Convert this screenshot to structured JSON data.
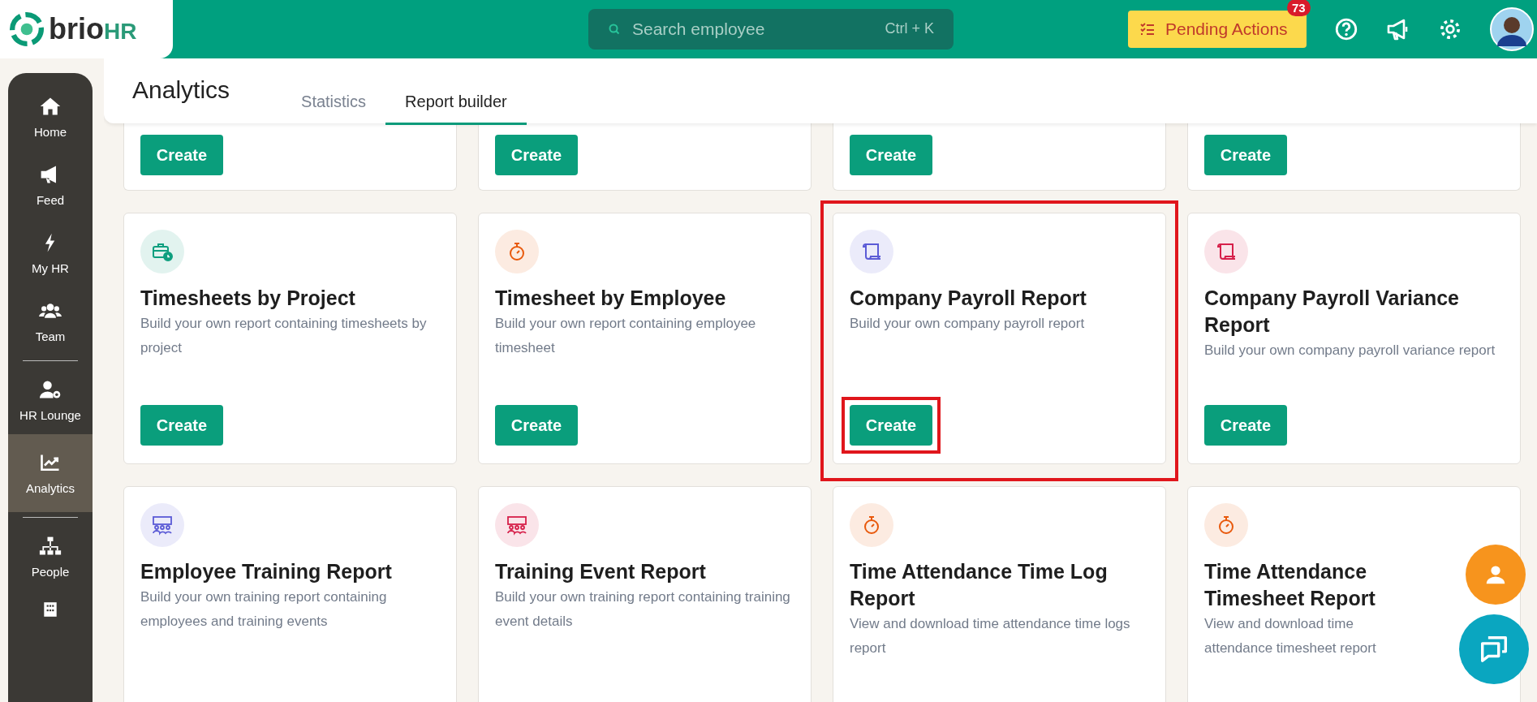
{
  "topbar": {
    "logo": {
      "name": "brio",
      "suffix": "HR"
    },
    "search": {
      "placeholder": "Search employee",
      "shortcut": "Ctrl + K"
    },
    "pending": {
      "label": "Pending Actions",
      "count": "73"
    }
  },
  "sidebar": {
    "items": [
      {
        "label": "Home",
        "selected": false,
        "divider_after": false
      },
      {
        "label": "Feed",
        "selected": false,
        "divider_after": false
      },
      {
        "label": "My HR",
        "selected": false,
        "divider_after": false
      },
      {
        "label": "Team",
        "selected": false,
        "divider_after": true
      },
      {
        "label": "HR Lounge",
        "selected": false,
        "divider_after": false
      },
      {
        "label": "Analytics",
        "selected": true,
        "divider_after": true
      },
      {
        "label": "People",
        "selected": false,
        "divider_after": false
      }
    ]
  },
  "header": {
    "title": "Analytics",
    "tabs": [
      {
        "label": "Statistics",
        "selected": false
      },
      {
        "label": "Report builder",
        "selected": true
      }
    ]
  },
  "rows": [
    {
      "cards": [
        {
          "button": "Create",
          "highlighted": false
        },
        {
          "button": "Create",
          "highlighted": false
        },
        {
          "button": "Create",
          "highlighted": false
        },
        {
          "button": "Create",
          "highlighted": false
        }
      ]
    },
    {
      "cards": [
        {
          "title": "Timesheets by Project",
          "description": "Build your own report containing timesheets by project",
          "button": "Create",
          "color": "#0f9f7f",
          "highlighted": false
        },
        {
          "title": "Timesheet by Employee",
          "description": "Build your own report containing employee timesheet",
          "button": "Create",
          "color": "#e8590c",
          "highlighted": false
        },
        {
          "title": "Company Payroll Report",
          "description": "Build your own company payroll report",
          "button": "Create",
          "color": "#5b5bd6",
          "highlighted": true
        },
        {
          "title": "Company Payroll Variance Report",
          "description": "Build your own company payroll variance report",
          "button": "Create",
          "color": "#d6204a",
          "highlighted": false
        }
      ]
    },
    {
      "cards": [
        {
          "title": "Employee Training Report",
          "description": "Build your own training report containing employees and training events",
          "color": "#5b5bd6",
          "highlighted": false
        },
        {
          "title": "Training Event Report",
          "description": "Build your own training report containing training event details",
          "color": "#d6204a",
          "highlighted": false
        },
        {
          "title": "Time Attendance Time Log Report",
          "description": "View and download time attendance time logs report",
          "color": "#e8590c",
          "highlighted": false
        },
        {
          "title": "Time Attendance Timesheet Report",
          "description": "View and download time attendance timesheet report",
          "color": "#e8590c",
          "highlighted": false
        }
      ]
    }
  ]
}
